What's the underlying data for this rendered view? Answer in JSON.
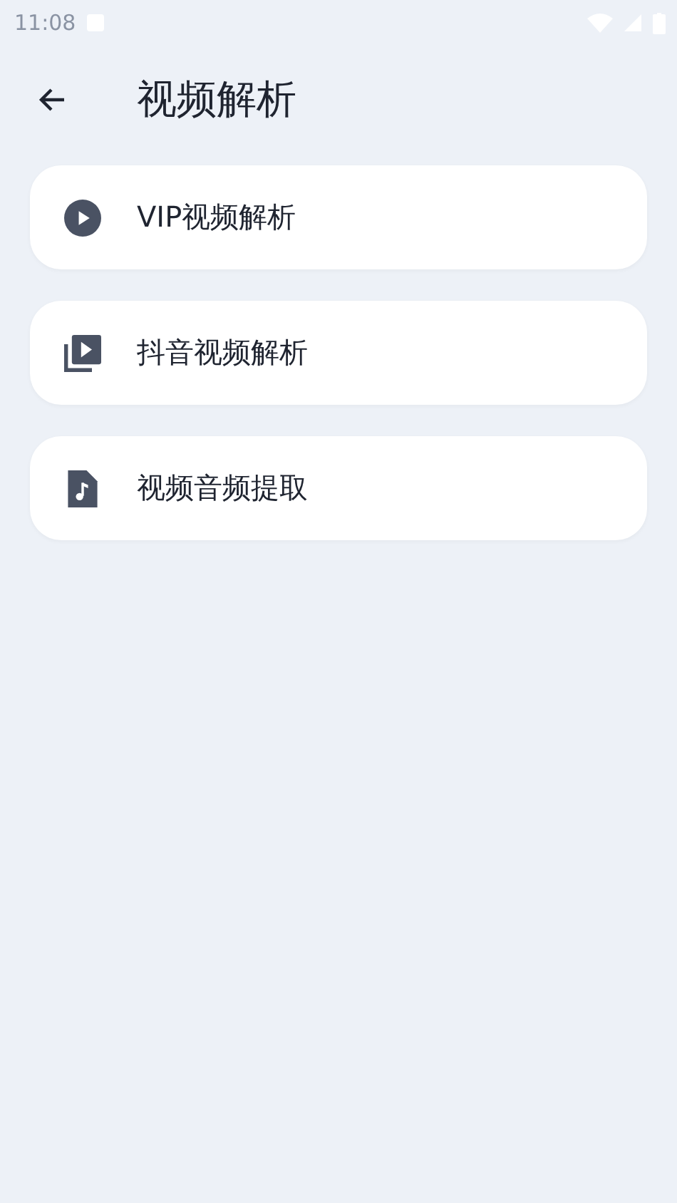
{
  "status_bar": {
    "time": "11:08"
  },
  "header": {
    "title": "视频解析"
  },
  "items": [
    {
      "kind": "play",
      "label": "VIP视频解析"
    },
    {
      "kind": "playlist",
      "label": "抖音视频解析"
    },
    {
      "kind": "music-file",
      "label": "视频音频提取"
    }
  ]
}
